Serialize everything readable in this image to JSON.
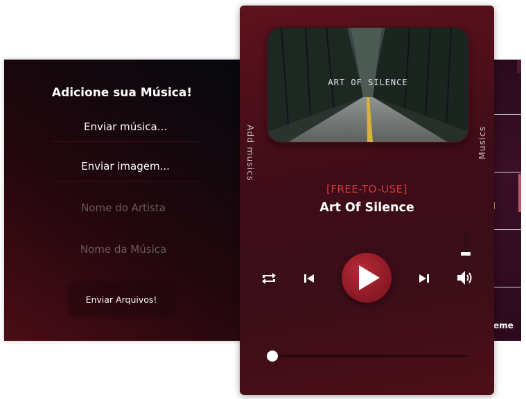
{
  "upload_form": {
    "title": "Adicione sua Música!",
    "send_music_label": "Enviar música...",
    "send_image_label": "Enviar imagem...",
    "artist_placeholder": "Nome do Artista",
    "song_placeholder": "Nome da Música",
    "submit_label": "Enviar Arquivos!"
  },
  "player": {
    "cover_text": "ART OF SILENCE",
    "tag": "[FREE-TO-USE]",
    "song_title": "Art Of Silence",
    "side_left_label": "Add musics",
    "side_right_label": "Musics",
    "progress": 0,
    "volume": 0.15
  },
  "playlist_panel": {
    "partial_text": "eme"
  },
  "icons": {
    "repeat": "repeat-icon",
    "previous": "skip-previous-icon",
    "play": "play-icon",
    "next": "skip-next-icon",
    "volume": "volume-icon"
  },
  "colors": {
    "accent_red": "#d63a3e",
    "play_button": "#9a1f2c",
    "text_white": "#ffffff"
  }
}
